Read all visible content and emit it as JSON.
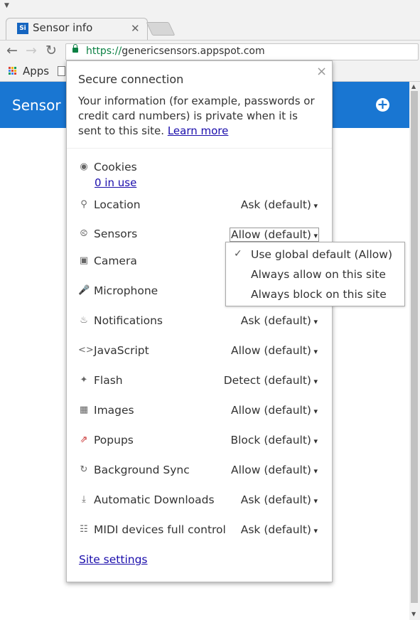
{
  "browser": {
    "tab_title": "Sensor info",
    "tab_favicon": "Si",
    "url_proto": "https://",
    "url_host": "genericsensors.appspot.com",
    "bookmarks_apps": "Apps"
  },
  "page": {
    "header_title": "Sensor info"
  },
  "popup": {
    "title": "Secure connection",
    "desc_text": "Your information (for example, passwords or credit card numbers) is private when it is sent to this site.",
    "learn_more": "Learn more",
    "cookies_label": "Cookies",
    "cookies_link": "0 in use",
    "permissions": [
      {
        "label": "Location",
        "value": "Ask (default)",
        "icon": "location-pin-icon"
      },
      {
        "label": "Sensors",
        "value": "Allow (default)",
        "icon": "sensors-icon"
      },
      {
        "label": "Camera",
        "value": "",
        "icon": "camera-icon"
      },
      {
        "label": "Microphone",
        "value": "",
        "icon": "microphone-icon"
      },
      {
        "label": "Notifications",
        "value": "Ask (default)",
        "icon": "bell-icon"
      },
      {
        "label": "JavaScript",
        "value": "Allow (default)",
        "icon": "code-icon"
      },
      {
        "label": "Flash",
        "value": "Detect (default)",
        "icon": "puzzle-icon"
      },
      {
        "label": "Images",
        "value": "Allow (default)",
        "icon": "image-icon"
      },
      {
        "label": "Popups",
        "value": "Block (default)",
        "icon": "popup-blocked-icon"
      },
      {
        "label": "Background Sync",
        "value": "Allow (default)",
        "icon": "sync-icon"
      },
      {
        "label": "Automatic Downloads",
        "value": "Ask (default)",
        "icon": "download-icon"
      },
      {
        "label": "MIDI devices full control",
        "value": "Ask (default)",
        "icon": "piano-icon"
      }
    ],
    "site_settings": "Site settings"
  },
  "dropdown": {
    "options": [
      "Use global default (Allow)",
      "Always allow on this site",
      "Always block on this site"
    ],
    "selected_index": 0
  },
  "colors": {
    "header_blue": "#1976d2",
    "secure_green": "#0b8043",
    "link_blue": "#1a0dab"
  }
}
